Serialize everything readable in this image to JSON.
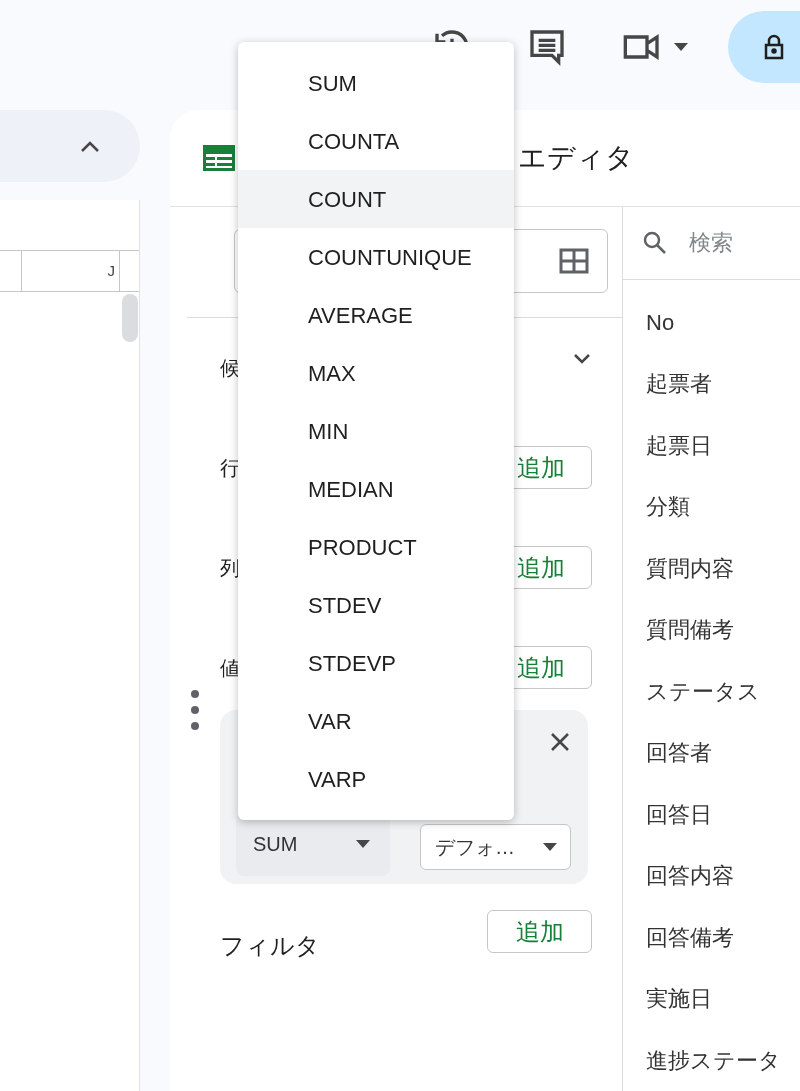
{
  "sheet": {
    "column_header": "J"
  },
  "editor": {
    "title": "エディタ",
    "sections": [
      {
        "label": "候",
        "kind": "collapsible"
      },
      {
        "label": "行",
        "kind": "add",
        "button": "追加"
      },
      {
        "label": "列",
        "kind": "add",
        "button": "追加"
      },
      {
        "label": "値",
        "kind": "add",
        "button": "追加"
      }
    ],
    "value_card": {
      "summarize_by": "SUM",
      "show_as": "デフォ…"
    },
    "filter": {
      "label": "フィルタ",
      "button": "追加"
    }
  },
  "fields": {
    "search_placeholder": "検索",
    "items": [
      "No",
      "起票者",
      "起票日",
      "分類",
      "質問内容",
      "質問備考",
      "ステータス",
      "回答者",
      "回答日",
      "回答内容",
      "回答備考",
      "実施日",
      "進捗ステータ"
    ]
  },
  "menu": {
    "items": [
      {
        "label": "SUM",
        "selected": false
      },
      {
        "label": "COUNTA",
        "selected": false
      },
      {
        "label": "COUNT",
        "selected": true
      },
      {
        "label": "COUNTUNIQUE",
        "selected": false
      },
      {
        "label": "AVERAGE",
        "selected": false
      },
      {
        "label": "MAX",
        "selected": false
      },
      {
        "label": "MIN",
        "selected": false
      },
      {
        "label": "MEDIAN",
        "selected": false
      },
      {
        "label": "PRODUCT",
        "selected": false
      },
      {
        "label": "STDEV",
        "selected": false
      },
      {
        "label": "STDEVP",
        "selected": false
      },
      {
        "label": "VAR",
        "selected": false
      },
      {
        "label": "VARP",
        "selected": false
      }
    ]
  }
}
